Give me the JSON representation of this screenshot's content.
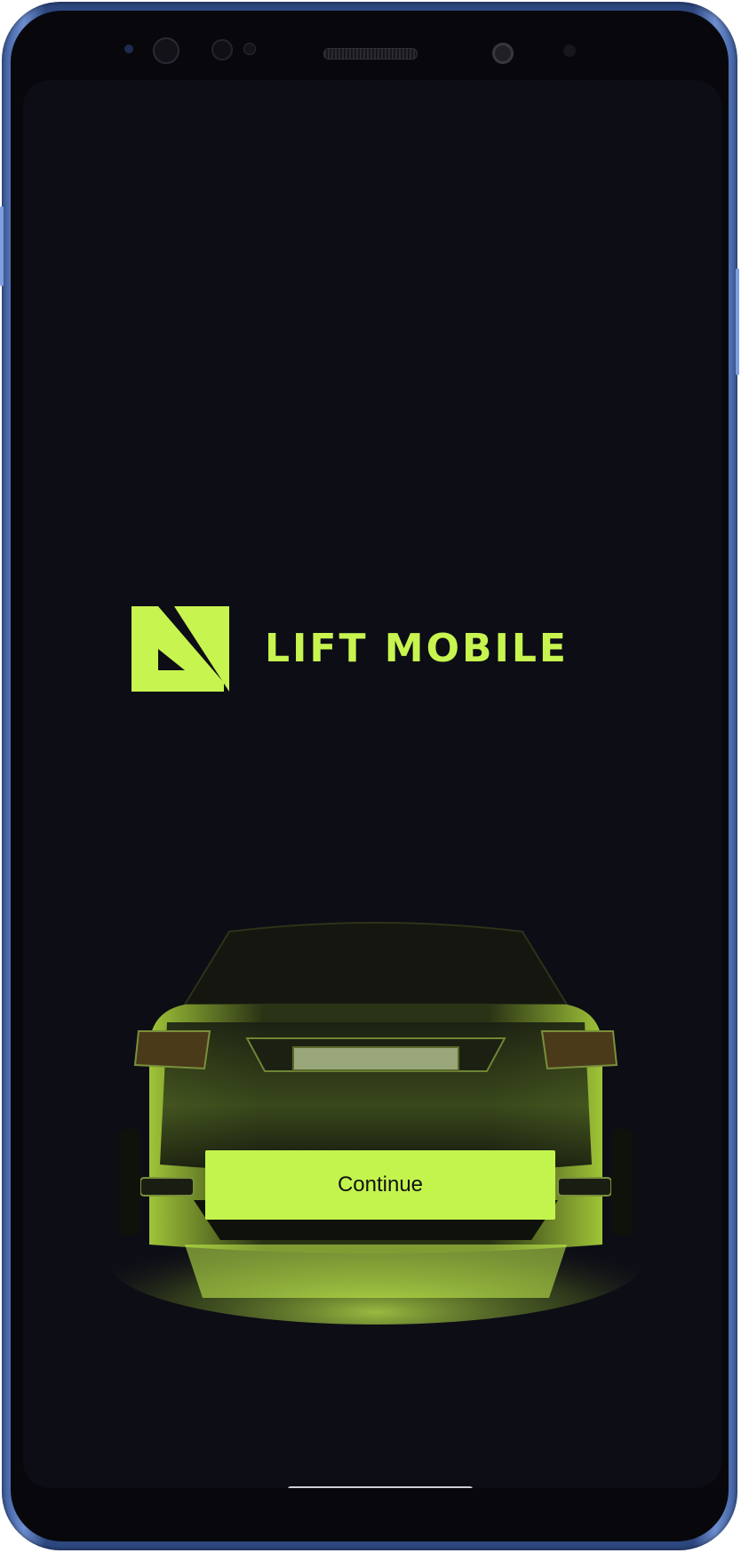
{
  "app": {
    "brand_name": "LIFT MOBILE",
    "brand_logo": "lift-mobile-logo",
    "accent_color": "#c7f44f",
    "background_color": "#0d0d16"
  },
  "hero": {
    "image": "car-rear-view"
  },
  "actions": {
    "continue_label": "Continue"
  }
}
